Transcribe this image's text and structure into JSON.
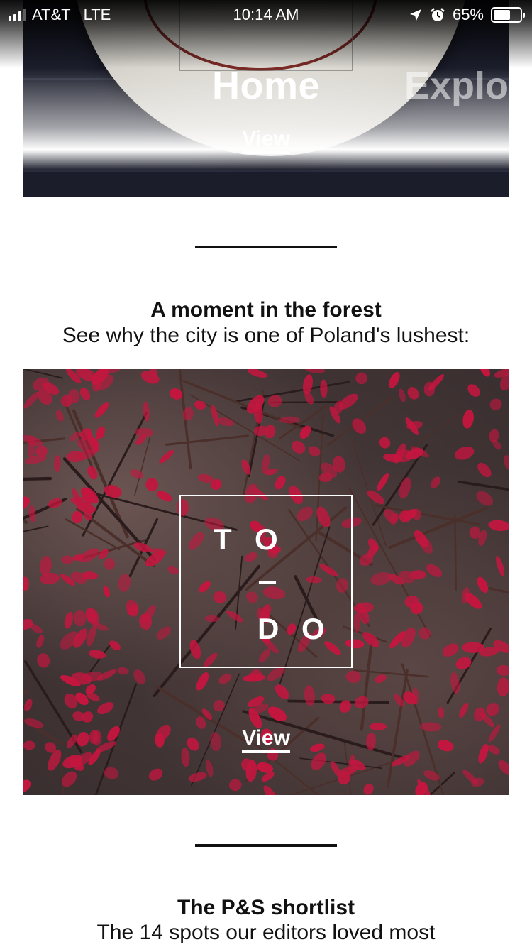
{
  "status_bar": {
    "carrier": "AT&T",
    "network": "LTE",
    "time": "10:14 AM",
    "battery": "65%",
    "battery_level": 0.65,
    "icons": [
      "signal-icon",
      "location-arrow-icon",
      "alarm-clock-icon",
      "battery-icon"
    ]
  },
  "hero": {
    "title": "Home",
    "next_title": "Explor",
    "view_label": "View"
  },
  "section_forest": {
    "title": "A moment in the forest",
    "subtitle": "See why the city is one of Poland's lushest:",
    "logo_letters": [
      "T",
      "O",
      "D",
      "O"
    ],
    "view_label": "View"
  },
  "section_shortlist": {
    "title": "The P&S shortlist",
    "subtitle": "The 14 spots our editors loved most"
  },
  "colors": {
    "text": "#111111",
    "background": "#ffffff",
    "berry": "#c4163f",
    "hero_dark": "#1b1d2b"
  }
}
